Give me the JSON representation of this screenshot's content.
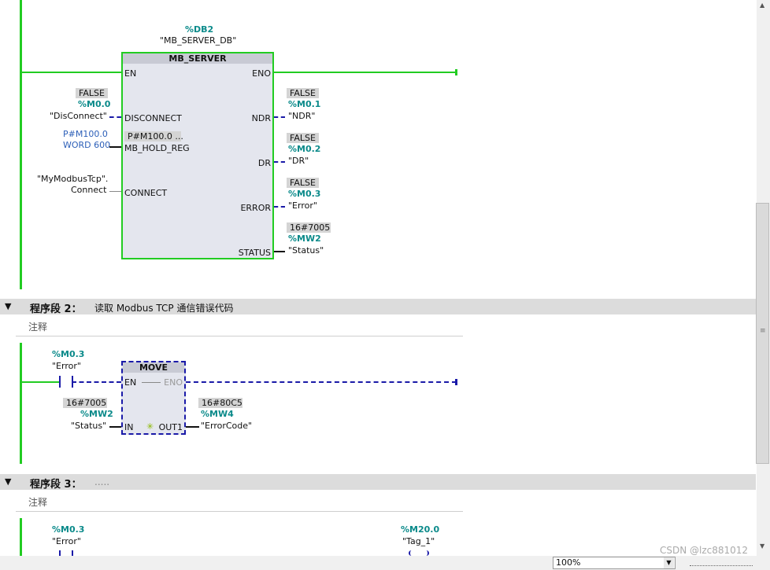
{
  "segment1": {
    "db_address": "%DB2",
    "db_name": "\"MB_SERVER_DB\"",
    "block_title": "MB_SERVER",
    "en": "EN",
    "eno": "ENO",
    "disconnect": {
      "value": "FALSE",
      "address": "%M0.0",
      "tag": "\"DisConnect\"",
      "pin": "DISCONNECT"
    },
    "hold_reg": {
      "line1": "P#M100.0",
      "line2": "WORD 600",
      "box_value": "P#M100.0 ...",
      "pin": "MB_HOLD_REG"
    },
    "connect": {
      "tag_line1": "\"MyModbusTcp\".",
      "tag_line2": "Connect",
      "pin": "CONNECT"
    },
    "ndr": {
      "value": "FALSE",
      "address": "%M0.1",
      "tag": "\"NDR\"",
      "pin": "NDR"
    },
    "dr": {
      "value": "FALSE",
      "address": "%M0.2",
      "tag": "\"DR\"",
      "pin": "DR"
    },
    "error": {
      "value": "FALSE",
      "address": "%M0.3",
      "tag": "\"Error\"",
      "pin": "ERROR"
    },
    "status": {
      "value": "16#7005",
      "address": "%MW2",
      "tag": "\"Status\"",
      "pin": "STATUS"
    }
  },
  "segment2": {
    "label": "程序段 2：",
    "title": "读取 Modbus TCP 通信错误代码",
    "comment": "注释",
    "contact": {
      "address": "%M0.3",
      "tag": "\"Error\""
    },
    "block_title": "MOVE",
    "en": "EN",
    "eno": "ENO",
    "in": {
      "value": "16#7005",
      "address": "%MW2",
      "tag": "\"Status\"",
      "pin": "IN"
    },
    "out1": {
      "value": "16#80C5",
      "address": "%MW4",
      "tag": "\"ErrorCode\"",
      "pin": "OUT1"
    },
    "star": "✳"
  },
  "segment3": {
    "label": "程序段 3：",
    "title": ".....",
    "comment": "注释",
    "contact": {
      "address": "%M0.3",
      "tag": "\"Error\""
    },
    "coil": {
      "address": "%M20.0",
      "tag": "\"Tag_1\""
    }
  },
  "footer": {
    "zoom": "100%",
    "watermark": "CSDN @lzc881012"
  },
  "colors": {
    "rail": "#22cc22",
    "address": "#0a8a8a",
    "dashed": "#1a1aa8"
  }
}
